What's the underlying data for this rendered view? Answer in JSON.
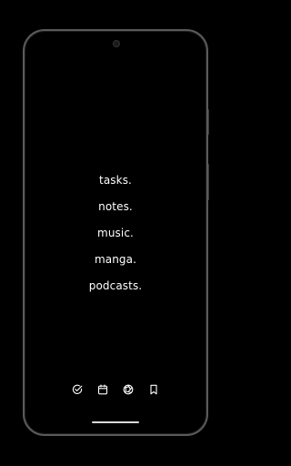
{
  "menu": {
    "items": [
      {
        "label": "tasks."
      },
      {
        "label": "notes."
      },
      {
        "label": "music."
      },
      {
        "label": "manga."
      },
      {
        "label": "podcasts."
      }
    ]
  },
  "nav": {
    "icons": [
      "check-circle-icon",
      "calendar-icon",
      "aperture-icon",
      "bookmark-icon"
    ]
  },
  "colors": {
    "background": "#000000",
    "text": "#ffffff",
    "frame": "#5a5a5a"
  }
}
